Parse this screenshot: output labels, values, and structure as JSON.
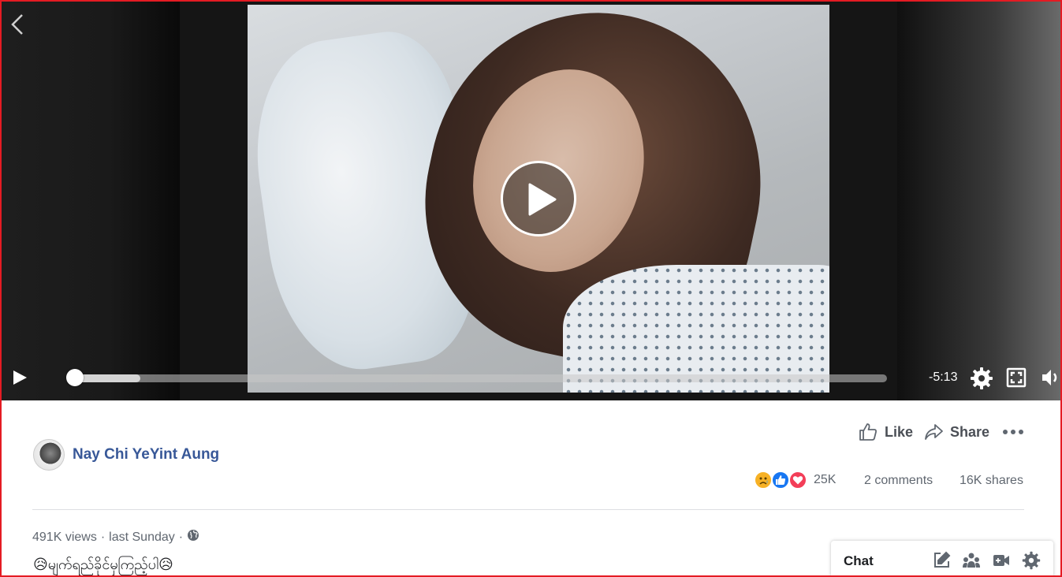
{
  "video": {
    "time_remaining": "-5:13",
    "progress": 0.0,
    "buffered": 0.085
  },
  "post": {
    "author": "Nay Chi YeYint Aung",
    "actions": {
      "like_label": "Like",
      "share_label": "Share"
    },
    "reactions": {
      "types": [
        "sad",
        "like",
        "love"
      ],
      "count": "25K"
    },
    "comments": "2 comments",
    "shares": "16K shares",
    "views": "491K views",
    "separator": "·",
    "posted": "last Sunday",
    "caption": "😥မျက်ရည်ခိုင်မှကြည့်ပါ😥"
  },
  "chat": {
    "label": "Chat"
  },
  "colors": {
    "author_link": "#385898",
    "border_highlight": "#e41b23",
    "like_blue": "#1877f2",
    "love_red": "#f33e58",
    "sad_yellow": "#f7b125"
  }
}
